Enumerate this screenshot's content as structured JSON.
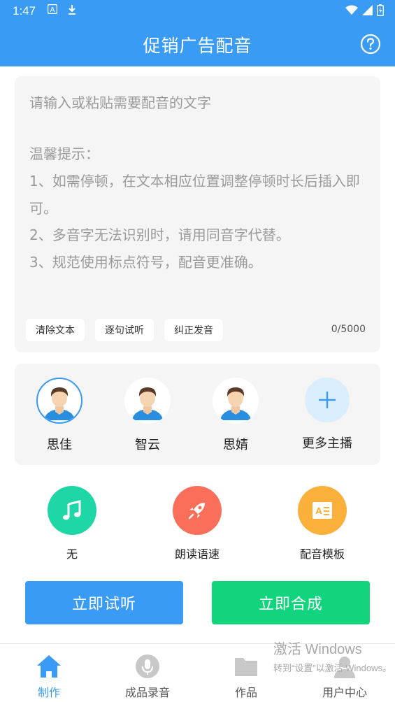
{
  "status_bar": {
    "time": "1:47",
    "left_icons": [
      "text-a-icon",
      "download-icon"
    ],
    "right_icons": [
      "wifi-icon",
      "signal-icon",
      "battery-icon"
    ]
  },
  "header": {
    "title": "促销广告配音",
    "help_icon": "help-icon"
  },
  "editor": {
    "placeholder": "请输入或粘贴需要配音的文字",
    "tips_title": "温馨提示：",
    "tips": [
      "1、如需停顿，在文本相应位置调整停顿时长后插入即可。",
      "2、多音字无法识别时，请用同音字代替。",
      "3、规范使用标点符号，配音更准确。"
    ],
    "buttons": [
      "清除文本",
      "逐句试听",
      "纠正发音"
    ],
    "counter": "0/5000"
  },
  "anchors": {
    "items": [
      {
        "name": "思佳",
        "selected": true
      },
      {
        "name": "智云",
        "selected": false
      },
      {
        "name": "思婧",
        "selected": false
      }
    ],
    "more_label": "更多主播"
  },
  "options": [
    {
      "label": "无",
      "icon": "music-note-icon",
      "color": "#1fd6a6"
    },
    {
      "label": "朗读语速",
      "icon": "rocket-icon",
      "color": "#fa6f5a"
    },
    {
      "label": "配音模板",
      "icon": "template-icon",
      "color": "#fbb03b"
    }
  ],
  "actions": {
    "preview_label": "立即试听",
    "preview_color": "#3a9bf4",
    "synthesize_label": "立即合成",
    "synthesize_color": "#12d47c"
  },
  "bottom_nav": {
    "items": [
      {
        "label": "制作",
        "icon": "home-icon",
        "active": true
      },
      {
        "label": "成品录音",
        "icon": "microphone-icon",
        "active": false
      },
      {
        "label": "作品",
        "icon": "folder-icon",
        "active": false
      },
      {
        "label": "用户中心",
        "icon": "user-icon",
        "active": false
      }
    ],
    "active_color": "#3a9bf4"
  },
  "watermark": {
    "title": "激活 Windows",
    "subtitle": "转到“设置”以激活 Windows。"
  }
}
